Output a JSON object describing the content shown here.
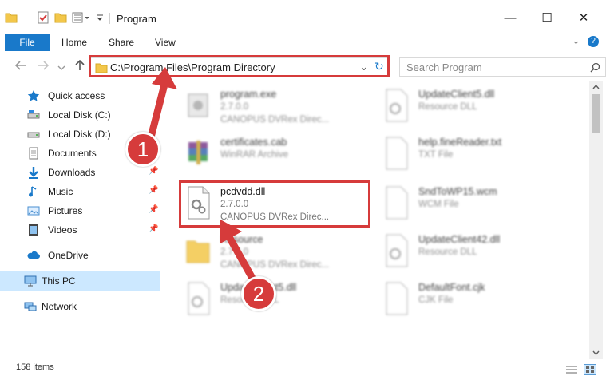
{
  "titlebar": {
    "title": "Program",
    "minimize_glyph": "—",
    "maximize_glyph": "☐",
    "close_glyph": "✕"
  },
  "ribbon": {
    "tabs": [
      "File",
      "Home",
      "Share",
      "View"
    ],
    "expand_glyph": "⌄",
    "help_glyph": "?"
  },
  "address": {
    "path": "C:\\Program Files\\Program Directory",
    "dropdown_glyph": "⌄",
    "refresh_glyph": "↻"
  },
  "search": {
    "placeholder": "Search Program"
  },
  "nav": {
    "items": [
      {
        "label": "Quick access",
        "icon": "star-icon",
        "pinned": false
      },
      {
        "label": "Local Disk (C:)",
        "icon": "drive-icon",
        "pinned": false
      },
      {
        "label": "Local Disk (D:)",
        "icon": "drive-icon",
        "pinned": false
      },
      {
        "label": "Documents",
        "icon": "documents-icon",
        "pinned": true
      },
      {
        "label": "Downloads",
        "icon": "download-icon",
        "pinned": true
      },
      {
        "label": "Music",
        "icon": "music-icon",
        "pinned": true
      },
      {
        "label": "Pictures",
        "icon": "pictures-icon",
        "pinned": true
      },
      {
        "label": "Videos",
        "icon": "videos-icon",
        "pinned": true
      },
      {
        "label": "OneDrive",
        "icon": "cloud-icon",
        "pinned": false
      },
      {
        "label": "This PC",
        "icon": "computer-icon",
        "pinned": false
      },
      {
        "label": "Network",
        "icon": "network-icon",
        "pinned": false
      }
    ],
    "pin_glyph": "📌"
  },
  "files": [
    {
      "name": "program.exe",
      "line2": "2.7.0.0",
      "line3": "CANOPUS DVRex Direc...",
      "icon": "exe-icon",
      "blurred": true
    },
    {
      "name": "UpdateClient5.dll",
      "line2": "Resource DLL",
      "line3": "",
      "icon": "dll-icon",
      "blurred": true
    },
    {
      "name": "certificates.cab",
      "line2": "WinRAR Archive",
      "line3": "",
      "icon": "archive-icon",
      "blurred": true
    },
    {
      "name": "help.fineReader.txt",
      "line2": "TXT File",
      "line3": "",
      "icon": "txt-icon",
      "blurred": true
    },
    {
      "name": "pcdvdd.dll",
      "line2": "2.7.0.0",
      "line3": "CANOPUS DVRex Direc...",
      "icon": "dll-icon",
      "blurred": false
    },
    {
      "name": "SndToWP15.wcm",
      "line2": "WCM File",
      "line3": "",
      "icon": "txt-icon",
      "blurred": true
    },
    {
      "name": "Resource",
      "line2": "2.7.0.0",
      "line3": "CANOPUS DVRex Direc...",
      "icon": "folder-icon",
      "blurred": true
    },
    {
      "name": "UpdateClient42.dll",
      "line2": "Resource DLL",
      "line3": "",
      "icon": "dll-icon",
      "blurred": true
    },
    {
      "name": "UpdateClient5.dll",
      "line2": "Resource DLL",
      "line3": "",
      "icon": "dll-icon",
      "blurred": true
    },
    {
      "name": "DefaultFont.cjk",
      "line2": "CJK File",
      "line3": "",
      "icon": "txt-icon",
      "blurred": true
    }
  ],
  "status": {
    "items_count": "158 items"
  },
  "annotations": {
    "step1": "1",
    "step2": "2"
  },
  "colors": {
    "accent": "#1979ca",
    "highlight": "#d63b3b",
    "selected": "#cce8ff"
  }
}
